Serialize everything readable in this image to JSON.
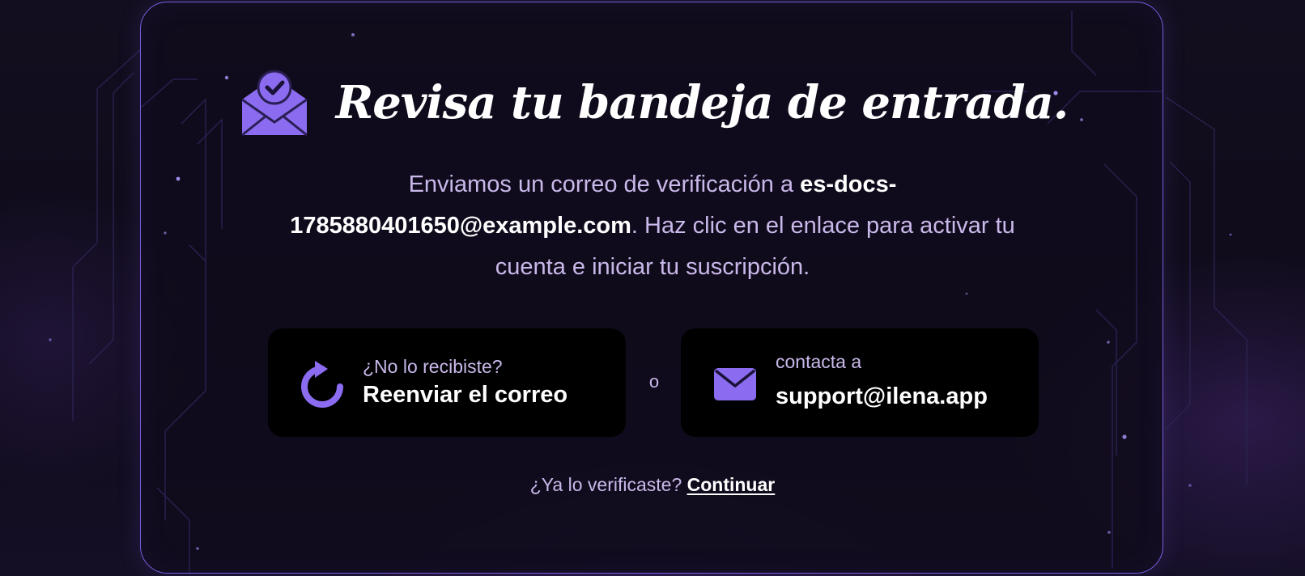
{
  "verify": {
    "title": "Revisa tu bandeja de entrada.",
    "message_prefix": "Enviamos un correo de verificación a ",
    "email": "es-docs-1785880401650@example.com",
    "message_suffix": ". Haz clic en el enlace para activar tu cuenta e iniciar tu suscripción.",
    "resend": {
      "question": "¿No lo recibiste?",
      "label": "Reenviar el correo"
    },
    "separator": "o",
    "contact": {
      "prefix": "contacta a",
      "email": "support@ilena.app"
    },
    "footer": {
      "question": "¿Ya lo verificaste?",
      "link": "Continuar"
    }
  },
  "icons": {
    "heading": "envelope-check-icon",
    "resend": "refresh-icon",
    "contact": "mail-icon"
  },
  "colors": {
    "accent": "#7c5ce0",
    "icon_fill": "#8b6cf0",
    "muted_text": "#c9b8ea",
    "card_border": "#7c5ce0",
    "button_bg": "#000000"
  }
}
